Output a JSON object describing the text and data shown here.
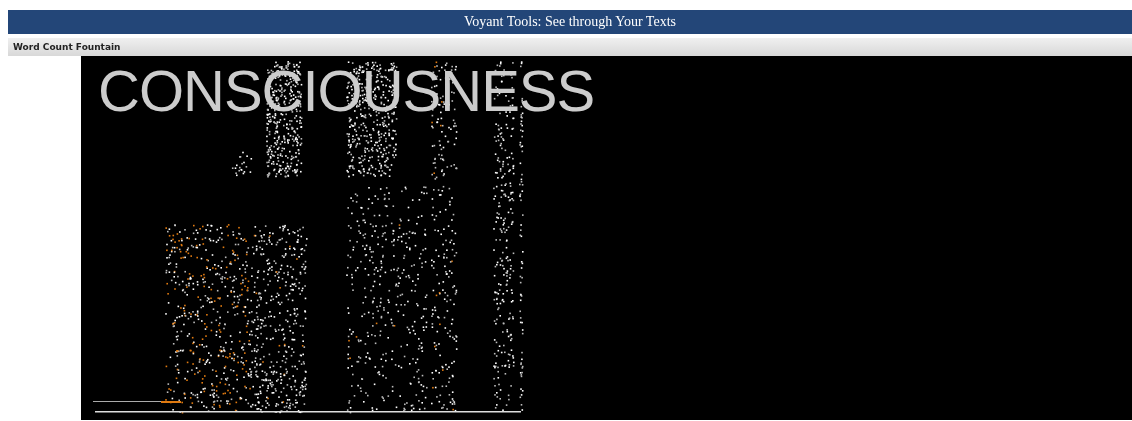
{
  "window": {
    "title": "Voyant Tools: See through Your Texts"
  },
  "panel": {
    "title": "Word Count Fountain"
  },
  "visualization": {
    "word": "CONSCIOUSNESS"
  }
}
